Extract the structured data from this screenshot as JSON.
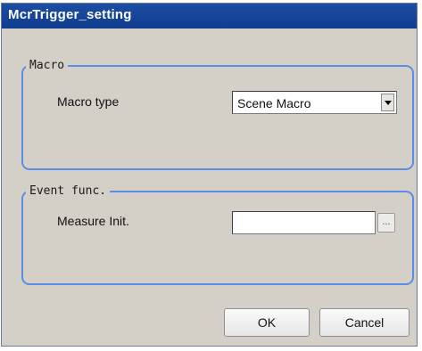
{
  "window": {
    "title": "McrTrigger_setting"
  },
  "macro_group": {
    "legend": "Macro",
    "macro_type_label": "Macro type",
    "macro_type_value": "Scene Macro"
  },
  "event_group": {
    "legend": "Event func.",
    "measure_init_label": "Measure Init.",
    "measure_init_value": "",
    "browse_label": "..."
  },
  "buttons": {
    "ok": "OK",
    "cancel": "Cancel"
  },
  "colors": {
    "titlebar": "#1347a0",
    "group_border": "#5a8de6",
    "dialog_bg": "#d4d0c8"
  }
}
